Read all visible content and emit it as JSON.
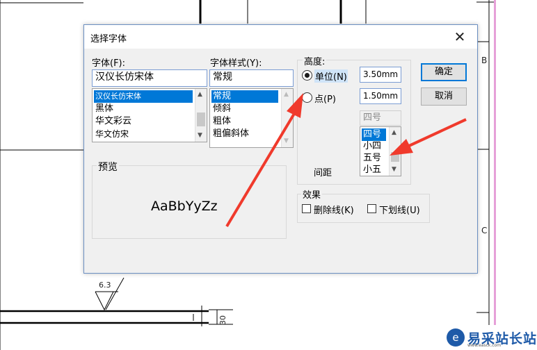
{
  "dialog": {
    "title": "选择字体",
    "close_glyph": "✕"
  },
  "font": {
    "label": "字体(F):",
    "value": "汉仪长仿宋体",
    "items": [
      "汉仪长仿宋体",
      "黑体",
      "华文彩云",
      "华文仿宋"
    ],
    "selected_index": 0
  },
  "style": {
    "label": "字体样式(Y):",
    "value": "常规",
    "items": [
      "常规",
      "倾斜",
      "粗体",
      "粗偏斜体"
    ],
    "selected_index": 0
  },
  "height": {
    "label": "高度:",
    "unit_label": "单位(N)",
    "unit_value": "3.50mm",
    "unit_selected": true,
    "point_label": "点(P)",
    "point_value": "1.50mm",
    "point_selected": false,
    "size_display": "四号",
    "size_items": [
      "四号",
      "小四",
      "五号",
      "小五"
    ],
    "size_selected_index": 0,
    "spacing_label": "间距"
  },
  "preview": {
    "label": "预览",
    "sample": "AaBbYyZz"
  },
  "effects": {
    "label": "效果",
    "strike_label": "删除线(K)",
    "strike_checked": false,
    "underline_label": "下划线(U)",
    "underline_checked": false
  },
  "buttons": {
    "ok": "确定",
    "cancel": "取消"
  },
  "drawing": {
    "zone_b": "B",
    "zone_c": "C",
    "roughness": "6.3",
    "dimension": "30"
  },
  "watermark": {
    "text": "易采站长站",
    "sub": "www.easck.com"
  },
  "colors": {
    "selection": "#0078d7",
    "arrow": "#f03a2c",
    "brand": "#1e5aa8"
  }
}
